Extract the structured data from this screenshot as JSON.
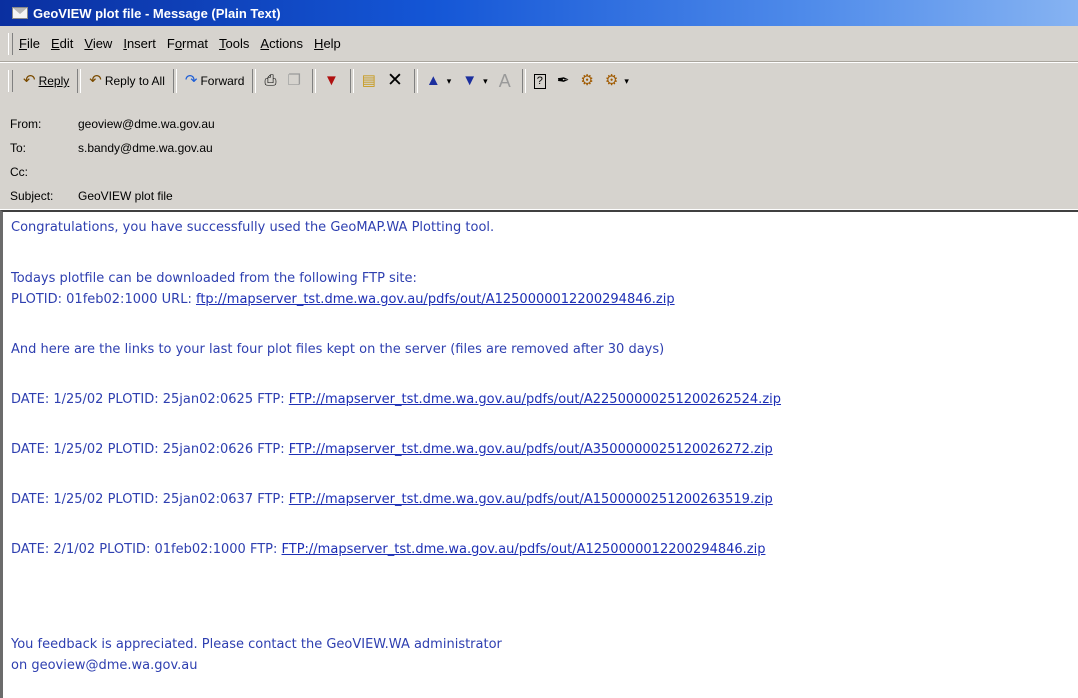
{
  "window": {
    "title": "GeoVIEW plot file - Message (Plain Text)"
  },
  "menu": [
    "File",
    "Edit",
    "View",
    "Insert",
    "Format",
    "Tools",
    "Actions",
    "Help"
  ],
  "toolbar": {
    "reply": "Reply",
    "reply_all": "Reply to All",
    "forward": "Forward"
  },
  "header": {
    "from_label": "From:",
    "from": "geoview@dme.wa.gov.au",
    "to_label": "To:",
    "to": "s.bandy@dme.wa.gov.au",
    "cc_label": "Cc:",
    "cc": "",
    "subject_label": "Subject:",
    "subject": "GeoVIEW plot file"
  },
  "body": {
    "congrats": "Congratulations, you have successfully used the GeoMAP.WA Plotting tool.",
    "download_intro": "Todays plotfile can be downloaded from the following FTP site:",
    "plot_prefix": "PLOTID: 01feb02:1000 URL: ",
    "plot_url": "ftp://mapserver_tst.dme.wa.gov.au/pdfs/out/A1250000012200294846.zip",
    "links_intro": "And here are the links to your last four plot files kept on the server (files are removed after 30 days)",
    "plots": [
      {
        "prefix": "DATE: 1/25/02 PLOTID: 25jan02:0625 FTP: ",
        "url": "FTP://mapserver_tst.dme.wa.gov.au/pdfs/out/A2250000025120026252​4.zip"
      },
      {
        "prefix": "DATE: 1/25/02 PLOTID: 25jan02:0626 FTP: ",
        "url": "FTP://mapserver_tst.dme.wa.gov.au/pdfs/out/A3500000025120026272.zip"
      },
      {
        "prefix": "DATE: 1/25/02 PLOTID: 25jan02:0637 FTP: ",
        "url": "FTP://mapserver_tst.dme.wa.gov.au/pdfs/out/A1500000251200263519.zip"
      },
      {
        "prefix": "DATE: 2/1/02 PLOTID: 01feb02:1000 FTP: ",
        "url": "FTP://mapserver_tst.dme.wa.gov.au/pdfs/out/A1250000012200294846.zip"
      }
    ],
    "feedback": "You feedback is appreciated. Please contact the GeoVIEW.WA administrator",
    "contact": "on geoview@dme.wa.gov.au"
  },
  "colors": {
    "title_bar": "#0a2fa0",
    "chrome": "#d6d3ce",
    "body_text": "#2e3fb0",
    "link": "#1d2fb5"
  }
}
